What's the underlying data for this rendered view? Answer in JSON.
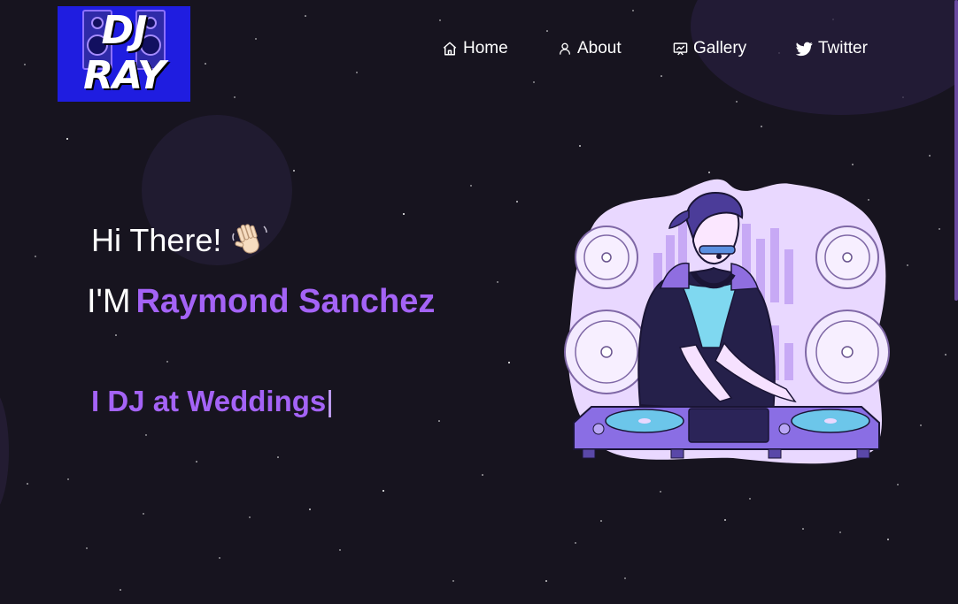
{
  "logo": {
    "text": "DJ RAY"
  },
  "nav": {
    "items": [
      {
        "label": "Home",
        "icon": "home-icon"
      },
      {
        "label": "About",
        "icon": "user-icon"
      },
      {
        "label": "Gallery",
        "icon": "gallery-icon"
      },
      {
        "label": "Twitter",
        "icon": "twitter-icon"
      }
    ]
  },
  "hero": {
    "greeting": "Hi There!",
    "name_prefix": "I'M",
    "name": "Raymond Sanchez",
    "typed_text": "I DJ at Weddings",
    "typed_cursor": "|",
    "illustration": "dj-illustration"
  },
  "colors": {
    "background": "#17141f",
    "accent": "#a463f6",
    "logo_bg": "#1f1de0",
    "illustration_bg": "#e9d8ff"
  }
}
